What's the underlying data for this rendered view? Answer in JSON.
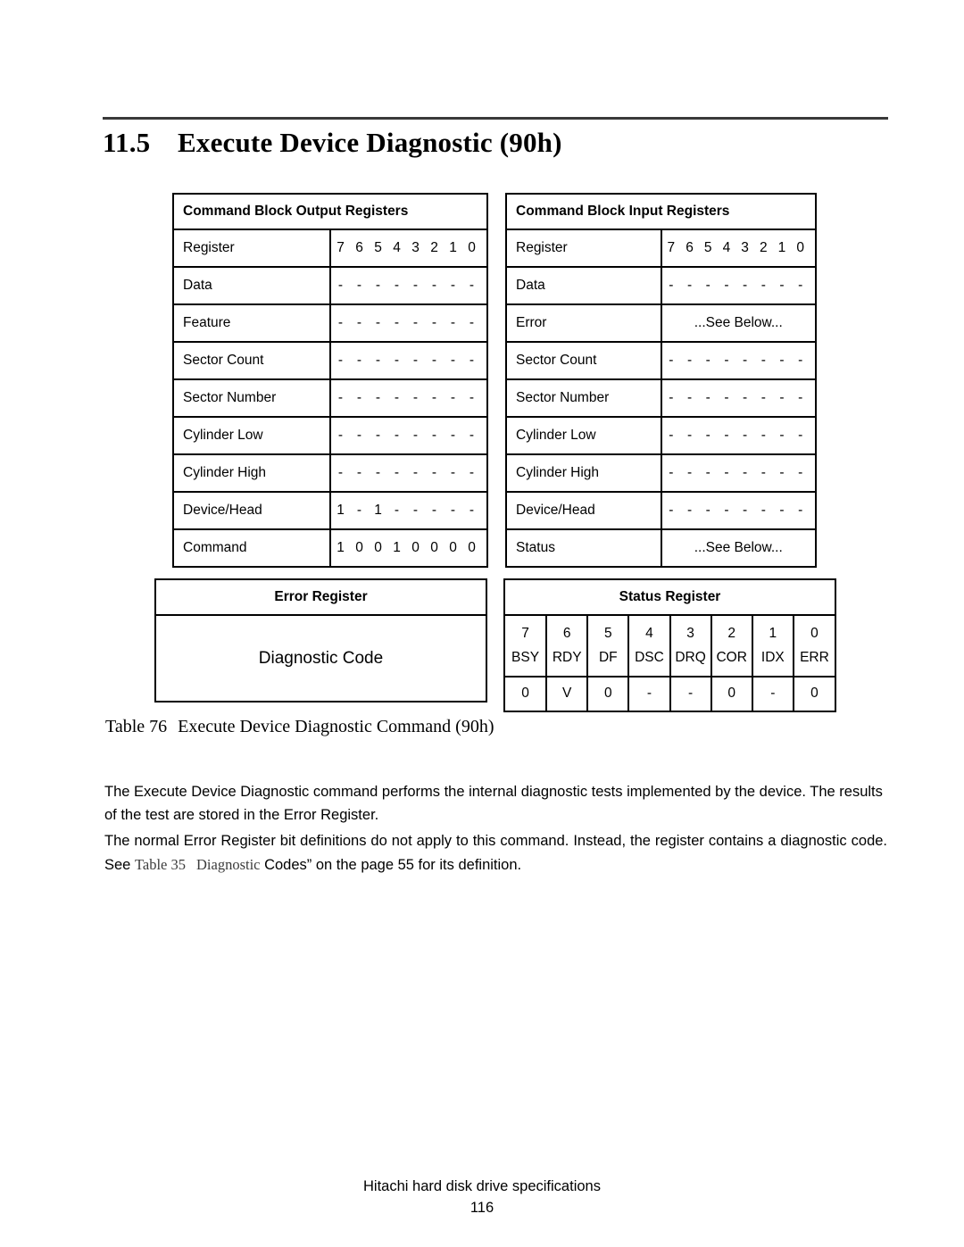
{
  "heading": {
    "number": "11.5",
    "title": "Execute Device Diagnostic (90h)"
  },
  "output_table": {
    "header": "Command Block Output Registers",
    "bit_header_label": "Register",
    "bit_numbers": [
      "7",
      "6",
      "5",
      "4",
      "3",
      "2",
      "1",
      "0"
    ],
    "rows": [
      {
        "label": "Data",
        "bits": [
          "-",
          "-",
          "-",
          "-",
          "-",
          "-",
          "-",
          "-"
        ]
      },
      {
        "label": "Feature",
        "bits": [
          "-",
          "-",
          "-",
          "-",
          "-",
          "-",
          "-",
          "-"
        ]
      },
      {
        "label": "Sector Count",
        "bits": [
          "-",
          "-",
          "-",
          "-",
          "-",
          "-",
          "-",
          "-"
        ]
      },
      {
        "label": "Sector Number",
        "bits": [
          "-",
          "-",
          "-",
          "-",
          "-",
          "-",
          "-",
          "-"
        ]
      },
      {
        "label": "Cylinder Low",
        "bits": [
          "-",
          "-",
          "-",
          "-",
          "-",
          "-",
          "-",
          "-"
        ]
      },
      {
        "label": "Cylinder High",
        "bits": [
          "-",
          "-",
          "-",
          "-",
          "-",
          "-",
          "-",
          "-"
        ]
      },
      {
        "label": "Device/Head",
        "bits": [
          "1",
          "-",
          "1",
          "-",
          "-",
          "-",
          "-",
          "-"
        ]
      },
      {
        "label": "Command",
        "bits": [
          "1",
          "0",
          "0",
          "1",
          "0",
          "0",
          "0",
          "0"
        ]
      }
    ]
  },
  "input_table": {
    "header": "Command Block Input Registers",
    "bit_header_label": "Register",
    "bit_numbers": [
      "7",
      "6",
      "5",
      "4",
      "3",
      "2",
      "1",
      "0"
    ],
    "rows": [
      {
        "label": "Data",
        "bits": [
          "-",
          "-",
          "-",
          "-",
          "-",
          "-",
          "-",
          "-"
        ]
      },
      {
        "label": "Error",
        "note": "...See Below..."
      },
      {
        "label": "Sector Count",
        "bits": [
          "-",
          "-",
          "-",
          "-",
          "-",
          "-",
          "-",
          "-"
        ]
      },
      {
        "label": "Sector Number",
        "bits": [
          "-",
          "-",
          "-",
          "-",
          "-",
          "-",
          "-",
          "-"
        ]
      },
      {
        "label": "Cylinder Low",
        "bits": [
          "-",
          "-",
          "-",
          "-",
          "-",
          "-",
          "-",
          "-"
        ]
      },
      {
        "label": "Cylinder High",
        "bits": [
          "-",
          "-",
          "-",
          "-",
          "-",
          "-",
          "-",
          "-"
        ]
      },
      {
        "label": "Device/Head",
        "bits": [
          "-",
          "-",
          "-",
          "-",
          "-",
          "-",
          "-",
          "-"
        ]
      },
      {
        "label": "Status",
        "note": "...See Below..."
      }
    ]
  },
  "error_register": {
    "header": "Error Register",
    "body": "Diagnostic Code"
  },
  "status_register": {
    "header": "Status Register",
    "bits": [
      {
        "number": "7",
        "name": "BSY",
        "value": "0"
      },
      {
        "number": "6",
        "name": "RDY",
        "value": "V"
      },
      {
        "number": "5",
        "name": "DF",
        "value": "0"
      },
      {
        "number": "4",
        "name": "DSC",
        "value": "-"
      },
      {
        "number": "3",
        "name": "DRQ",
        "value": "-"
      },
      {
        "number": "2",
        "name": "COR",
        "value": "0"
      },
      {
        "number": "1",
        "name": "IDX",
        "value": "-"
      },
      {
        "number": "0",
        "name": "ERR",
        "value": "0"
      }
    ]
  },
  "caption": {
    "number": "Table 76",
    "text": "Execute Device Diagnostic Command (90h)"
  },
  "paragraphs": {
    "p1": "The Execute Device Diagnostic command performs the internal diagnostic tests implemented by the device. The results of the test are stored in the Error Register.",
    "p2_before": "The normal Error Register bit definitions do not apply to this command. Instead, the register contains a diagnostic code. See ",
    "p2_ref_a": "Table 35",
    "p2_ref_b": "Diagnostic",
    "p2_after": " Codes” on the page 55 for its definition."
  },
  "footer": {
    "text": "Hitachi hard disk drive specifications",
    "page": "116"
  }
}
